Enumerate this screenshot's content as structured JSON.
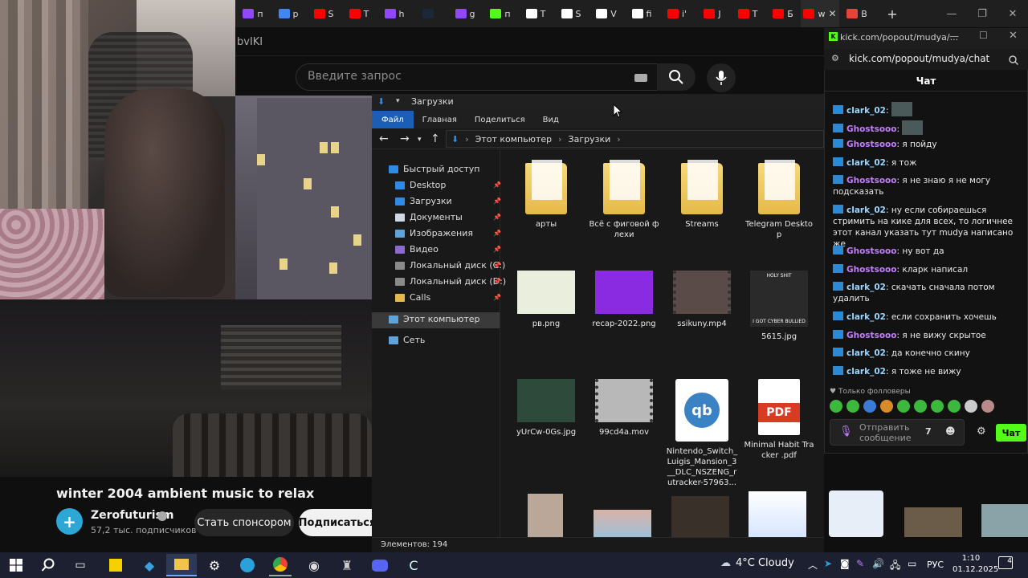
{
  "browser": {
    "tabs": [
      {
        "label": "п",
        "color": "#9146ff"
      },
      {
        "label": "р",
        "color": "#4285f4"
      },
      {
        "label": "S",
        "color": "#ff0000"
      },
      {
        "label": "Т",
        "color": "#ff0000"
      },
      {
        "label": "h",
        "color": "#9146ff"
      },
      {
        "label": "",
        "color": "#1b2838"
      },
      {
        "label": "g",
        "color": "#9146ff"
      },
      {
        "label": "п",
        "color": "#53fc18"
      },
      {
        "label": "Т",
        "color": "#ffffff"
      },
      {
        "label": "S",
        "color": "#ffffff"
      },
      {
        "label": "V",
        "color": "#ffffff"
      },
      {
        "label": "fi",
        "color": "#ffffff"
      },
      {
        "label": "i'",
        "color": "#ff0000"
      },
      {
        "label": "Ј",
        "color": "#ff0000"
      },
      {
        "label": "Т",
        "color": "#ff0000"
      },
      {
        "label": "Б",
        "color": "#ff0000"
      },
      {
        "label": "w",
        "color": "#ff0000"
      },
      {
        "label": "B",
        "color": "#ea4335"
      }
    ],
    "active_tab_close": "✕",
    "new_tab": "+",
    "url_fragment": "bvIKI"
  },
  "youtube": {
    "search_placeholder": "Введите запрос",
    "video_title": "winter 2004 ambient music to relax",
    "channel": {
      "name": "Zerofuturism",
      "subscribers": "57,2 тыс. подписчиков"
    },
    "sponsor_label": "Стать спонсором",
    "subscribe_label": "Подписаться"
  },
  "explorer": {
    "title": "Загрузки",
    "ribbon": [
      "Файл",
      "Главная",
      "Поделиться",
      "Вид"
    ],
    "path": [
      "Этот компьютер",
      "Загрузки"
    ],
    "nav": [
      {
        "label": "Быстрый доступ",
        "icon": "star-icon",
        "color": "#2e8ae6",
        "pinned": false
      },
      {
        "label": "Desktop",
        "icon": "desktop-icon",
        "color": "#2e8ae6",
        "pinned": true
      },
      {
        "label": "Загрузки",
        "icon": "download-icon",
        "color": "#2e8ae6",
        "pinned": true
      },
      {
        "label": "Документы",
        "icon": "documents-icon",
        "color": "#cfd8e3",
        "pinned": true
      },
      {
        "label": "Изображения",
        "icon": "pictures-icon",
        "color": "#5ea3d9",
        "pinned": true
      },
      {
        "label": "Видео",
        "icon": "video-icon",
        "color": "#8b6ad1",
        "pinned": true
      },
      {
        "label": "Локальный диск (C:)",
        "icon": "drive-icon",
        "color": "#8a8a8a",
        "pinned": true
      },
      {
        "label": "Локальный диск (D:)",
        "icon": "drive-icon",
        "color": "#8a8a8a",
        "pinned": true
      },
      {
        "label": "Calls",
        "icon": "folder-icon",
        "color": "#e6b94a",
        "pinned": true
      },
      {
        "label": "Этот компьютер",
        "icon": "computer-icon",
        "color": "#5ea3d9",
        "pinned": false
      },
      {
        "label": "Сеть",
        "icon": "network-icon",
        "color": "#5ea3d9",
        "pinned": false
      }
    ],
    "files": [
      {
        "name": "арты",
        "kind": "folder"
      },
      {
        "name": "Всё с фиговой флехи",
        "kind": "folder"
      },
      {
        "name": "Streams",
        "kind": "folder"
      },
      {
        "name": "Telegram Desktop",
        "kind": "folder"
      },
      {
        "name": "рв.png",
        "kind": "image",
        "color": "#e9eedd"
      },
      {
        "name": "recap-2022.png",
        "kind": "image",
        "color": "#8a2be2"
      },
      {
        "name": "ssikuny.mp4",
        "kind": "video",
        "color": "#5a4a48"
      },
      {
        "name": "5615.jpg",
        "kind": "image",
        "color": "#2a2a2a",
        "caption_top": "HOLY SHIT",
        "caption_bottom": "I GOT CYBER BULLIED"
      },
      {
        "name": "yUrCw-0Gs.jpg",
        "kind": "image",
        "color": "#2d4a3a"
      },
      {
        "name": "99cd4a.mov",
        "kind": "video",
        "color": "#b8b8b8"
      },
      {
        "name": "Nintendo_Switch_Luigis_Mansion_3__DLC_NSZENG_rutracker-57963...",
        "kind": "qbittorrent"
      },
      {
        "name": "Minimal Habit Tracker .pdf",
        "kind": "pdf",
        "badge": "PDF"
      }
    ],
    "status": "Элементов: 194"
  },
  "kick": {
    "window_title": "kick.com/popout/mudya/...",
    "url": "kick.com/popout/mudya/chat",
    "header": "Чат",
    "messages": [
      {
        "user": "clark_02",
        "text": "",
        "type": "clark",
        "emote": true
      },
      {
        "user": "Ghostsooo",
        "text": "",
        "type": "ghost",
        "emote": true
      },
      {
        "user": "Ghostsooo",
        "text": "я пойду",
        "type": "ghost"
      },
      {
        "user": "clark_02",
        "text": "я тож",
        "type": "clark"
      },
      {
        "user": "Ghostsooo",
        "text": "я не знаю  я не могу подсказать",
        "type": "ghost"
      },
      {
        "user": "clark_02",
        "text": "ну если собираешься стримить на кике для всех, то логичнее этот канал указать тут mudya написано же",
        "type": "clark"
      },
      {
        "user": "Ghostsooo",
        "text": "ну вот да",
        "type": "ghost"
      },
      {
        "user": "Ghostsooo",
        "text": "кларк написал",
        "type": "ghost"
      },
      {
        "user": "clark_02",
        "text": "скачать сначала потом удалить",
        "type": "clark"
      },
      {
        "user": "clark_02",
        "text": "если сохранить хочешь",
        "type": "clark"
      },
      {
        "user": "Ghostsooo",
        "text": "я не вижу скрытое",
        "type": "ghost"
      },
      {
        "user": "clark_02",
        "text": "да конечно  скину",
        "type": "clark"
      },
      {
        "user": "clark_02",
        "text": "я тоже не вижу",
        "type": "clark"
      }
    ],
    "followers_only": "Только фолловеры",
    "input_placeholder": "Отправить сообщение",
    "send_label": "Чат"
  },
  "taskbar": {
    "weather": "4°C  Cloudy",
    "lang": "РУС",
    "time": "1:10",
    "date": "01.12.2025",
    "notifications": "4"
  }
}
